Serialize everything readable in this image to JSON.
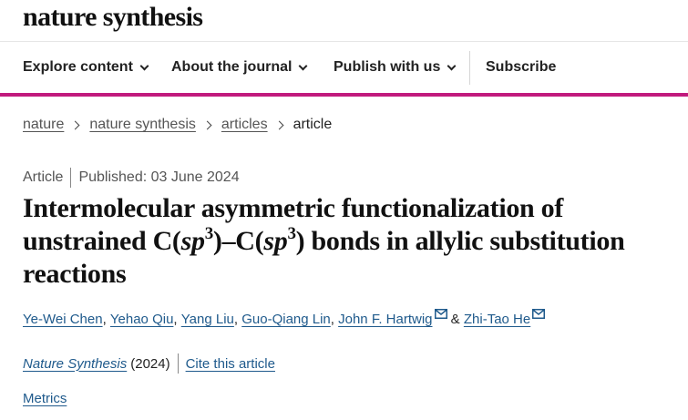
{
  "header": {
    "logo_text": "nature synthesis"
  },
  "nav": {
    "items": [
      {
        "label": "Explore content"
      },
      {
        "label": "About the journal"
      },
      {
        "label": "Publish with us"
      }
    ],
    "subscribe_label": "Subscribe",
    "accent_color": "#c11a7d"
  },
  "breadcrumb": {
    "items": [
      {
        "label": "nature"
      },
      {
        "label": "nature synthesis"
      },
      {
        "label": "articles"
      }
    ],
    "current": "article"
  },
  "article": {
    "type": "Article",
    "published": "Published: 03 June 2024",
    "title": {
      "line1": "Intermolecular asymmetric functionalization of",
      "line2_pre": "unstrained C(",
      "sp": "sp",
      "exp": "3",
      "mid": ")–C(",
      "line2_post": ") bonds in allylic substitution",
      "line3": "reactions"
    },
    "authors": [
      "Ye-Wei Chen",
      "Yehao Qiu",
      "Yang Liu",
      "Guo-Qiang Lin",
      "John F. Hartwig",
      "Zhi-Tao He"
    ],
    "author_sep": ",",
    "author_and": "&",
    "journal": "Nature Synthesis",
    "year": "(2024)",
    "cite_label": "Cite this article",
    "metrics_label": "Metrics",
    "link_color": "#1f5a8c"
  }
}
